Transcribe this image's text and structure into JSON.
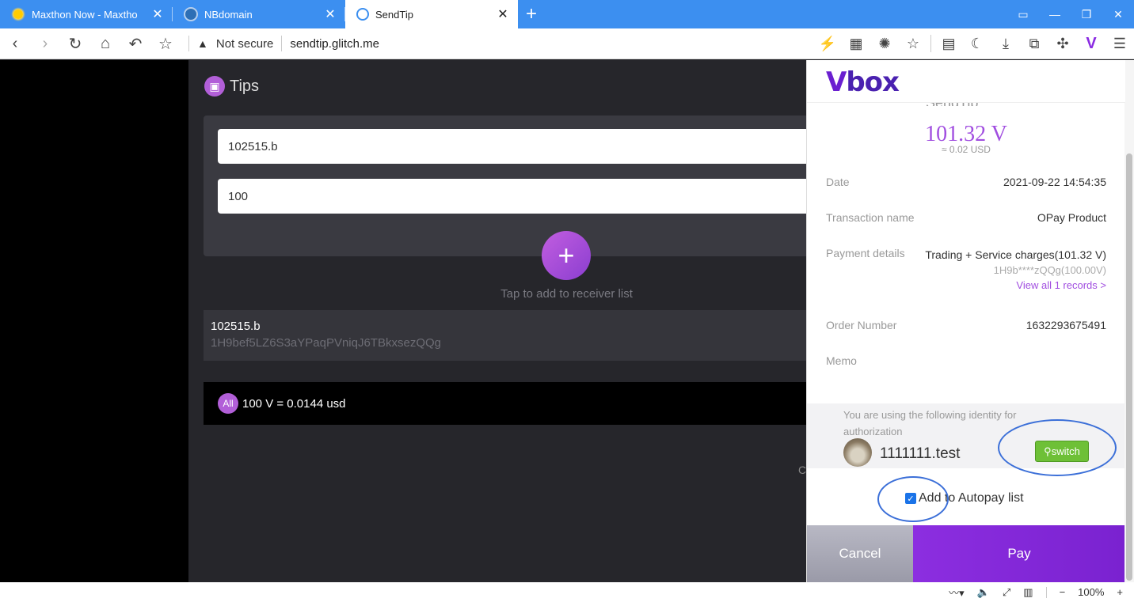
{
  "tabs": [
    {
      "title": "Maxthon Now - Maxtho",
      "icon": "sun-icon",
      "active": false
    },
    {
      "title": "NBdomain",
      "icon": "nbdomain-icon",
      "active": false
    },
    {
      "title": "SendTip",
      "icon": "sendtip-icon",
      "active": true
    }
  ],
  "tab_close": "✕",
  "new_tab": "+",
  "address": {
    "security": "Not secure",
    "url": "sendtip.glitch.me"
  },
  "app": {
    "title": "Tips",
    "receiver_input": "102515.b",
    "amount_input": "100",
    "add_button": "+",
    "add_hint": "Tap to add to receiver list",
    "receiver": {
      "name": "102515.b",
      "address": "1H9bef5LZ6S3aYPaqPVniqJ6TBkxsezQQg"
    },
    "all_badge": "All",
    "summary": "100 V = 0.0144 usd",
    "side_char": "C"
  },
  "vbox": {
    "logo_v": "V",
    "logo_box": "box",
    "ghost_title": "SendTip",
    "amount": "101.32 V",
    "amount_usd": "≈ 0.02 USD",
    "date_label": "Date",
    "date_value": "2021-09-22 14:54:35",
    "txname_label": "Transaction name",
    "txname_value": "OPay Product",
    "payment_label": "Payment details",
    "payment_main": "Trading + Service charges(101.32 V)",
    "payment_sub": "1H9b****zQQg(100.00V)",
    "payment_link": "View all 1 records >",
    "order_label": "Order Number",
    "order_value": "1632293675491",
    "memo_label": "Memo",
    "identity_hint": "You are using the following identity for authorization",
    "identity_name": "1111111.test",
    "switch_label": "switch",
    "autopay_label": "Add to Autopay list",
    "autopay_checked": true,
    "cancel_label": "Cancel",
    "pay_label": "Pay",
    "accent_color": "#a14ee0",
    "pay_color": "#8c2ee0"
  },
  "status": {
    "zoom": "100%",
    "minus": "−",
    "plus": "+"
  }
}
